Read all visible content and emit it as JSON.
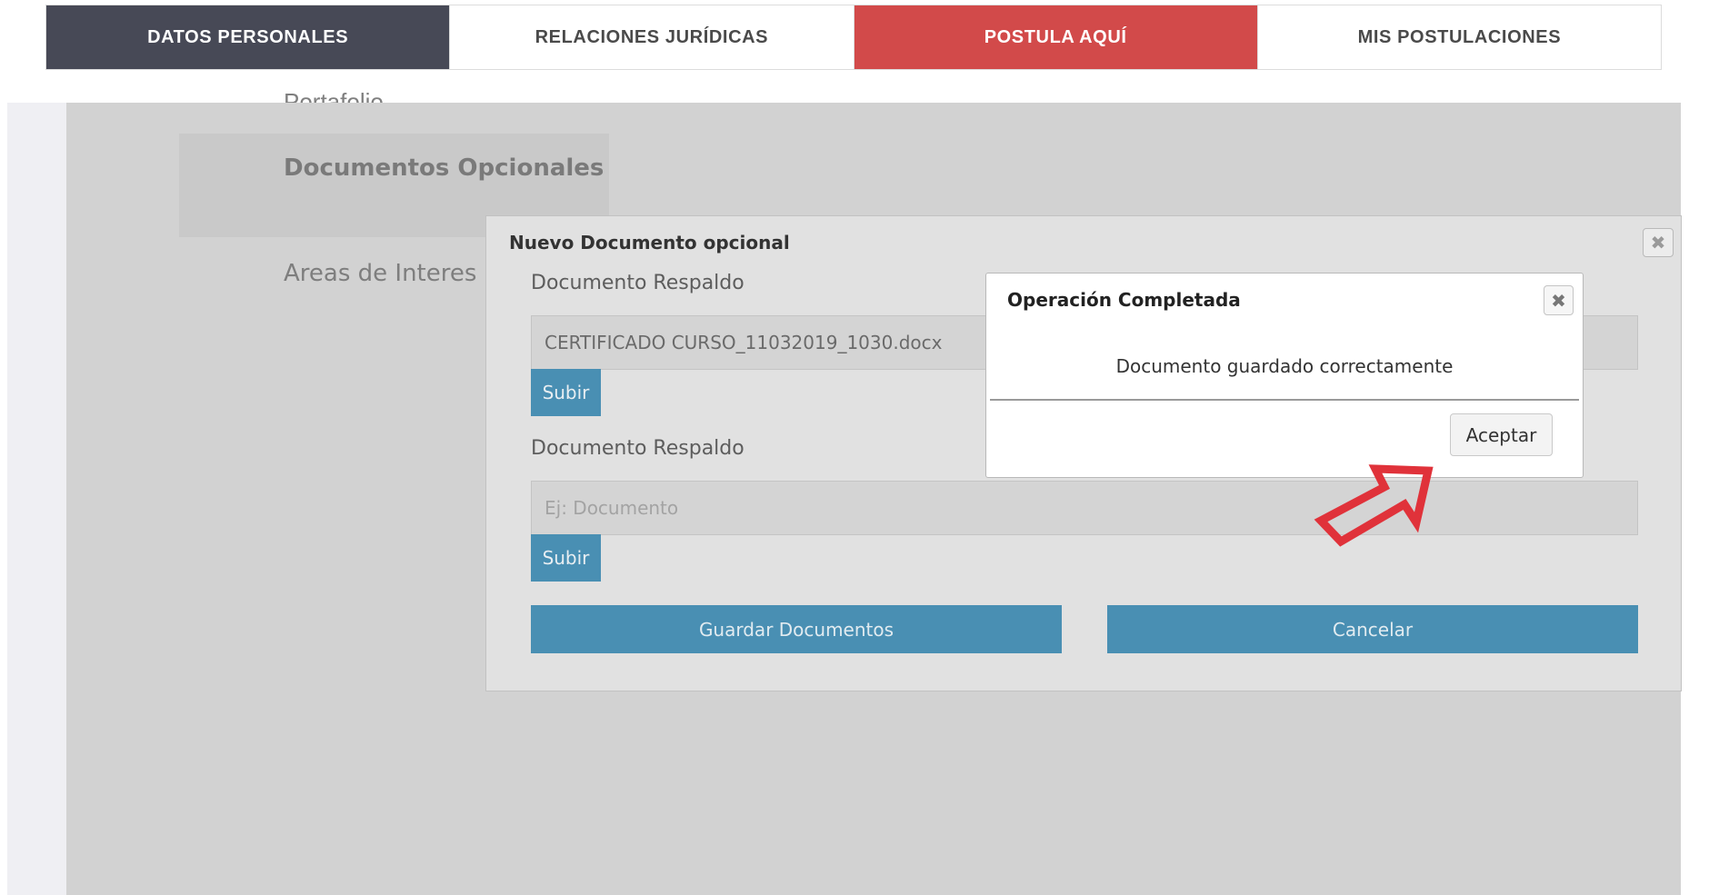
{
  "nav": {
    "tabs": [
      {
        "label": "DATOS PERSONALES"
      },
      {
        "label": "RELACIONES JURÍDICAS"
      },
      {
        "label": "POSTULA AQUÍ"
      },
      {
        "label": "MIS POSTULACIONES"
      }
    ]
  },
  "sidebar": {
    "cut_item": "Portafolio",
    "active_item": "Documentos Opcionales",
    "item_areas": "Areas de Interes"
  },
  "modal": {
    "title": "Nuevo Documento opcional",
    "field1_label": "Documento Respaldo",
    "field1_value": "CERTIFICADO CURSO_11032019_1030.docx",
    "field2_label": "Documento Respaldo",
    "field2_placeholder": "Ej: Documento",
    "upload_label": "Subir",
    "save_label": "Guardar Documentos",
    "cancel_label": "Cancelar"
  },
  "dialog": {
    "title": "Operación Completada",
    "message": "Documento guardado correctamente",
    "accept_label": "Aceptar"
  },
  "colors": {
    "nav_dark": "#474956",
    "nav_red": "#d24a4a",
    "button_blue": "#498fb3",
    "arrow_red": "#e0323a"
  },
  "icons": {
    "close": "close-icon",
    "annotation_arrow": "arrow-annotation-icon"
  }
}
